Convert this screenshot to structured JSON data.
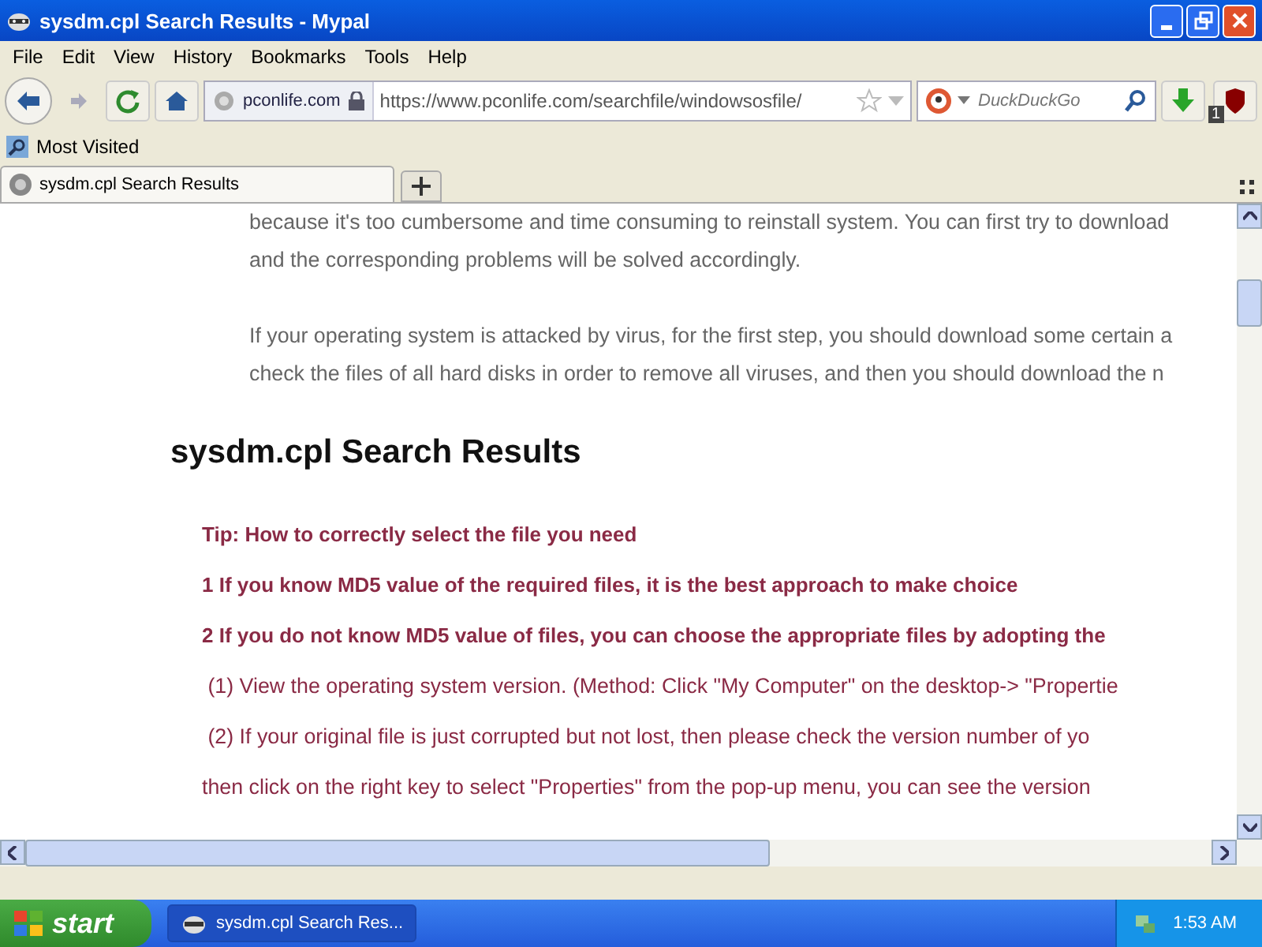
{
  "window": {
    "title": "sysdm.cpl Search Results - Mypal"
  },
  "menu": [
    {
      "label": "File"
    },
    {
      "label": "Edit"
    },
    {
      "label": "View"
    },
    {
      "label": "History"
    },
    {
      "label": "Bookmarks"
    },
    {
      "label": "Tools"
    },
    {
      "label": "Help"
    }
  ],
  "toolbar": {
    "site_identity": "pconlife.com",
    "url": "https://www.pconlife.com/searchfile/windowsosfile/",
    "search_placeholder": "DuckDuckGo",
    "addon_badge": "1"
  },
  "bookmarks": [
    {
      "label": "Most Visited"
    }
  ],
  "tabs": [
    {
      "label": "sysdm.cpl Search Results",
      "selected": true
    }
  ],
  "content": {
    "paragraphs": [
      [
        "because it's too cumbersome and time consuming to reinstall system. You can first try to download",
        "and the corresponding problems will be solved accordingly."
      ],
      [
        "If your operating system is attacked by virus, for the first step, you should download some certain a",
        "check the files of all hard disks in order to remove all viruses, and then you should download the n"
      ]
    ],
    "heading": "sysdm.cpl Search Results",
    "tips": [
      {
        "kind": "bold",
        "text": "Tip: How to correctly select the file you need"
      },
      {
        "kind": "bold",
        "text": "1 If you know MD5 value of the required files, it is the best approach to make choice"
      },
      {
        "kind": "bold",
        "text": "2 If you do not know MD5 value of files, you can choose the appropriate files by adopting the"
      },
      {
        "kind": "text",
        "text": " (1) View the operating system version. (Method: Click \"My Computer\" on the desktop-> \"Propertie"
      },
      {
        "kind": "text",
        "text": " (2) If your original file is just corrupted but not lost, then please check the version number of yo"
      },
      {
        "kind": "text",
        "text": "then click on the right key to select \"Properties\" from the pop-up menu, you can see the version"
      }
    ]
  },
  "taskbar": {
    "start": "start",
    "tasks": [
      {
        "label": "sysdm.cpl Search Res...",
        "selected": true
      }
    ],
    "clock": "1:53 AM"
  }
}
